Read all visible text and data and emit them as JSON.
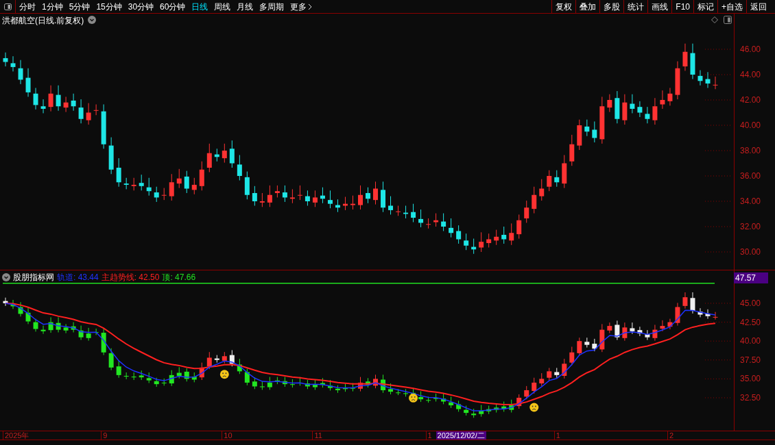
{
  "toolbar": {
    "periods": [
      {
        "label": "分时",
        "selected": false
      },
      {
        "label": "1分钟",
        "selected": false
      },
      {
        "label": "5分钟",
        "selected": false
      },
      {
        "label": "15分钟",
        "selected": false
      },
      {
        "label": "30分钟",
        "selected": false
      },
      {
        "label": "60分钟",
        "selected": false
      },
      {
        "label": "日线",
        "selected": true
      },
      {
        "label": "周线",
        "selected": false
      },
      {
        "label": "月线",
        "selected": false
      },
      {
        "label": "多周期",
        "selected": false
      }
    ],
    "more": "更多",
    "buttons": [
      "复权",
      "叠加",
      "多股",
      "统计",
      "画线",
      "F10",
      "标记",
      "+自选",
      "返回"
    ]
  },
  "price_chart": {
    "title": "洪都航空(日线.前复权)",
    "axis_labels": [
      "46.00",
      "44.00",
      "42.00",
      "40.00",
      "38.00",
      "36.00",
      "34.00",
      "32.00",
      "30.00"
    ]
  },
  "indicator": {
    "name": "股朋指标网",
    "legend": [
      {
        "label": "轨道: 43.44",
        "color": "#1e32ff"
      },
      {
        "label": "主趋势线: 42.50",
        "color": "#ff2020"
      },
      {
        "label": "顶: 47.66",
        "color": "#20e020"
      }
    ],
    "top_badge": "47.57",
    "axis_labels": [
      "45.00",
      "42.50",
      "40.00",
      "37.50",
      "35.00",
      "32.50"
    ]
  },
  "date_axis": {
    "labels": [
      "2025年",
      "9",
      "10",
      "11",
      "1",
      "1",
      "2"
    ],
    "cursor": "2025/12/02/二"
  }
}
